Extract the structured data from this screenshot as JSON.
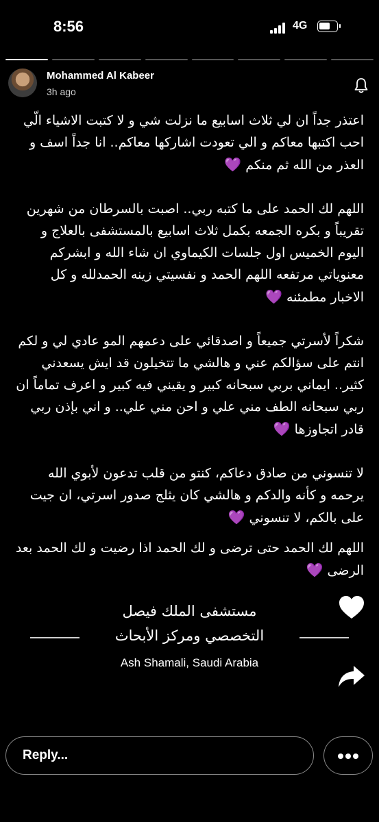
{
  "status_bar": {
    "time": "8:56",
    "network": "4G",
    "battery_level": 0.7,
    "signal_bars": 4
  },
  "story": {
    "progress_segments": 8,
    "active_segment_index": 0,
    "author": {
      "name": "Mohammed Al Kabeer",
      "time_ago": "3h ago"
    },
    "paragraphs": [
      "اعتذر جداً ان لي ثلاث اسابيع ما نزلت شي و لا كتبت الاشياء الّي احب اكتبها معاكم و الي تعودت اشاركها معاكم.. انا جداً اسف و العذر من الله ثم منكم",
      "اللهم لك الحمد على ما كتبه ربي.. اصبت بالسرطان من شهرين تقريباً و بكره الجمعه بكمل ثلاث اسابيع بالمستشفى بالعلاج و اليوم الخميس اول جلسات الكيماوي ان شاء الله و ابشركم معنوياتي مرتفعه اللهم الحمد و نفسيتي زينه الحمدلله و كل الاخبار مطمئنه",
      "شكراً لأسرتي جميعاً و اصدقائي على دعمهم المو عادي لي و لكم انتم على سؤالكم عني و هالشي ما تتخيلون قد ايش يسعدني كثير.. ايماني بربي سبحانه كبير و يقيني فيه كبير و اعرف تماماً ان ربي سبحانه الطف مني علي و احن مني علي.. و اني بإذن ربي قادر اتجاوزها",
      "لا تنسوني من صادق دعاكم، كنتو من قلب تدعون لأبوي الله يرحمه و كأنه والدكم و هالشي كان يثلج صدور اسرتي، ان جيت على بالكم، لا تنسوني",
      "اللهم لك الحمد حتى ترضى و لك الحمد اذا رضيت و لك الحمد بعد الرضى"
    ],
    "heart_emoji": "💜",
    "location": {
      "name_ar_line1": "مستشفى الملك فيصل",
      "name_ar_line2": "التخصصي ومركز الأبحاث",
      "region": "Ash Shamali, Saudi Arabia"
    },
    "reply_placeholder": "Reply..."
  },
  "icons": {
    "bell": "bell-icon",
    "like": "heart-icon",
    "share": "share-arrow-icon",
    "more": "more-dots-icon"
  },
  "colors": {
    "background": "#000000",
    "text": "#ffffff",
    "purple_heart": "#a855f7",
    "border": "#8a8a8a"
  }
}
